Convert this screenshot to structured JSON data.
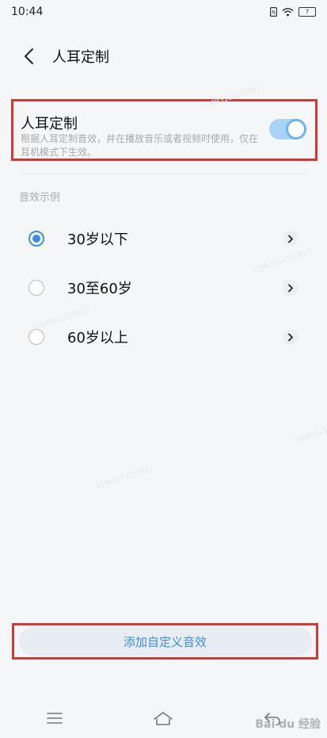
{
  "status_bar": {
    "time": "10:44",
    "battery": "7"
  },
  "header": {
    "title": "人耳定制"
  },
  "toggle": {
    "title": "人耳定制",
    "description": "根据人耳定制音效，并在播放音乐或者视频时使用，仅在耳机模式下生效。",
    "enabled": true
  },
  "section": {
    "header": "音效示例"
  },
  "options": [
    {
      "label": "30岁以下",
      "selected": true
    },
    {
      "label": "30至60岁",
      "selected": false
    },
    {
      "label": "60岁以上",
      "selected": false
    }
  ],
  "add_button": {
    "label": "添加自定义音效"
  },
  "watermarks": {
    "text": "V1003111222817"
  },
  "baidu": {
    "text": "Bai du 经验"
  },
  "colors": {
    "accent": "#3a8ee6",
    "highlight_box": "#d23a3a"
  }
}
